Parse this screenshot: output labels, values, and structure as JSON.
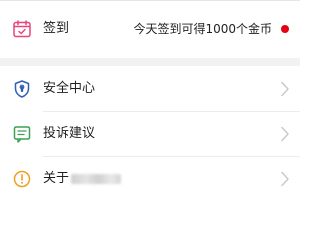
{
  "signin": {
    "label": "签到",
    "hint": "今天签到可得1000个金币",
    "icon": "calendar-icon",
    "accent": "#e8457a"
  },
  "menu": {
    "security": {
      "label": "安全中心",
      "icon": "shield-icon",
      "color": "#2f5fb5"
    },
    "complaint": {
      "label": "投诉建议",
      "icon": "message-icon",
      "color": "#3aa357"
    },
    "about": {
      "label": "关于",
      "icon": "info-icon",
      "color": "#f0a020"
    }
  },
  "colors": {
    "dot": "#e60012",
    "chevron": "#c8c8c8",
    "background": "#f2f2f2"
  }
}
